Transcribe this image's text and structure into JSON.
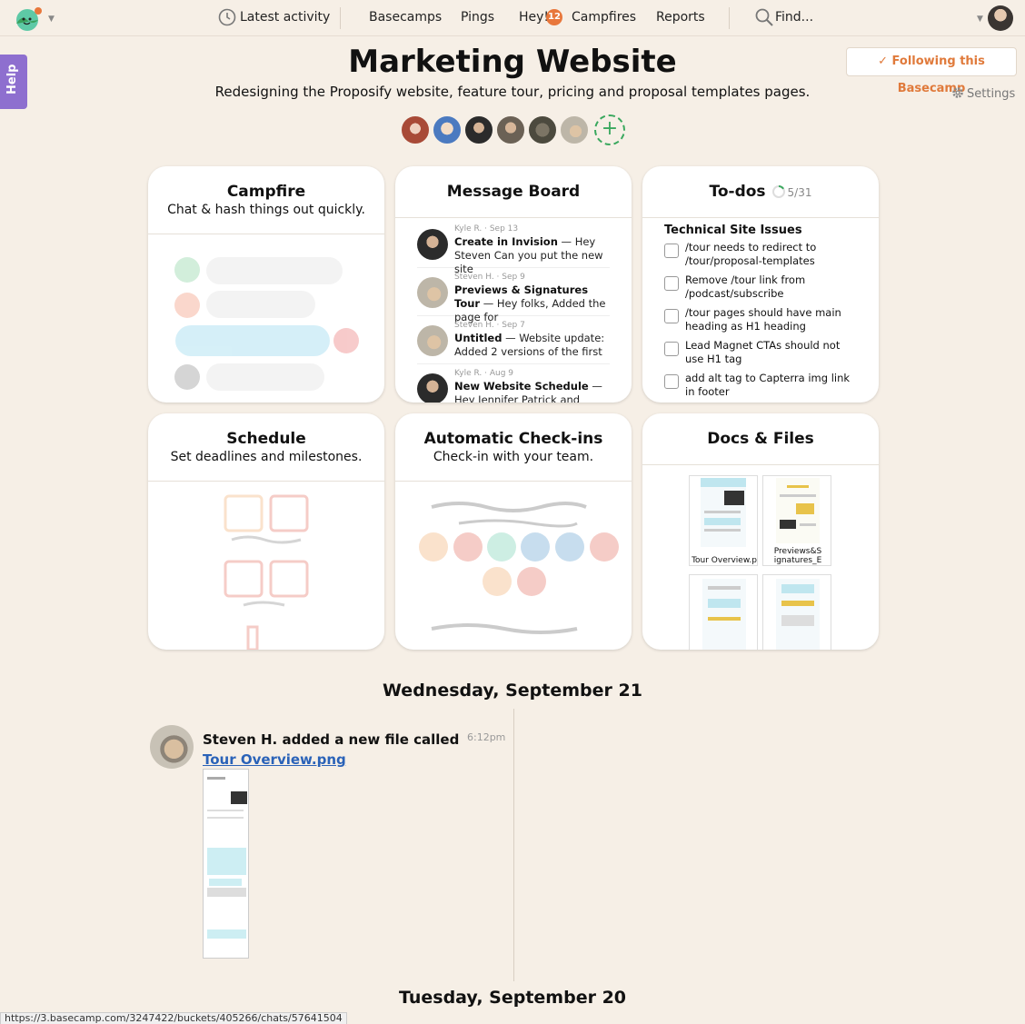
{
  "nav": {
    "latest_activity": "Latest activity",
    "basecamps": "Basecamps",
    "pings": "Pings",
    "hey": "Hey!",
    "hey_count": "12",
    "campfires": "Campfires",
    "reports": "Reports",
    "find": "Find..."
  },
  "help": "Help",
  "project": {
    "title": "Marketing Website",
    "description": "Redesigning the Proposify website, feature tour, pricing and proposal templates pages.",
    "follow_label": "✓ Following this Basecamp",
    "settings_label": "Settings"
  },
  "cards": {
    "campfire": {
      "title": "Campfire",
      "desc": "Chat & hash things out quickly."
    },
    "message_board": {
      "title": "Message Board",
      "messages": [
        {
          "meta": "Kyle R. · Sep 13",
          "subject": "Create in Invision",
          "preview": " — Hey Steven  Can you put the new site"
        },
        {
          "meta": "Steven H. · Sep 9",
          "subject": "Previews & Signatures Tour",
          "preview": " — Hey folks, Added the page for"
        },
        {
          "meta": "Steven H. · Sep 7",
          "subject": "Untitled",
          "preview": " — Website update: Added 2 versions of the first"
        },
        {
          "meta": "Kyle R. · Aug 9",
          "subject": "New Website Schedule",
          "preview": " — Hey Jennifer Patrick and Steven  I"
        }
      ]
    },
    "todos": {
      "title": "To-dos",
      "count": "5/31",
      "progress": 0.16,
      "list_title": "Technical Site Issues",
      "items": [
        "/tour needs to redirect to /tour/proposal-templates",
        "Remove /tour link from /podcast/subscribe",
        "/tour pages should have main heading as H1 heading",
        "Lead Magnet CTAs should not use H1 tag",
        "add alt tag to Capterra img link in footer"
      ]
    },
    "schedule": {
      "title": "Schedule",
      "desc": "Set deadlines and milestones."
    },
    "checkins": {
      "title": "Automatic Check-ins",
      "desc": "Check-in with your team."
    },
    "docs": {
      "title": "Docs & Files",
      "files": [
        "Tour Overview.p",
        "Previews&S ignatures_E"
      ]
    }
  },
  "timeline": {
    "days": [
      {
        "heading": "Wednesday, September 21",
        "entries": [
          {
            "text": "Steven H. added a new file called ",
            "link": "Tour Overview.png",
            "time": "6:12pm"
          }
        ]
      },
      {
        "heading": "Tuesday, September 20"
      }
    ]
  },
  "status_url": "https://3.basecamp.com/3247422/buckets/405266/chats/57641504",
  "colors": {
    "accent": "#e07a3b",
    "help": "#8e6fcf",
    "link": "#2a62b8",
    "add": "#3aa85e",
    "background": "#f6efe6"
  }
}
